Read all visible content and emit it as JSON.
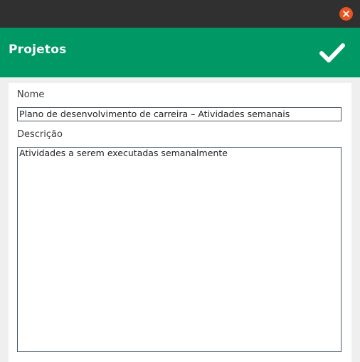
{
  "window": {
    "close_icon": "close-icon",
    "accent_color": "#e95420"
  },
  "header": {
    "title": "Projetos",
    "confirm_icon": "checkmark-icon",
    "background_color": "#009966"
  },
  "form": {
    "name_label": "Nome",
    "name_value": "Plano de desenvolvimento de carreira – Atividades semanais",
    "description_label": "Descrição",
    "description_value": "Atividades a serem executadas semanalmente"
  }
}
